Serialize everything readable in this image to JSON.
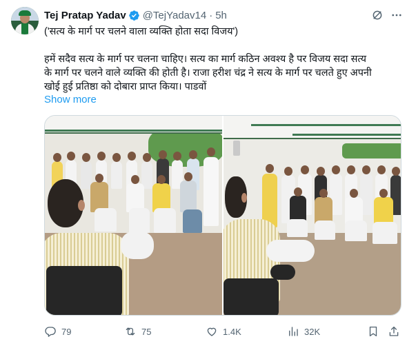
{
  "author": {
    "name": "Tej Pratap Yadav",
    "handle": "@TejYadav14",
    "separator": "·",
    "time": "5h",
    "avatar_icon": "profile-avatar"
  },
  "tweet": {
    "line1": "('सत्य के मार्ग पर चलने वाला व्यक्ति होता सदा विजय')",
    "body_lines": [
      "हमें सदैव सत्य के मार्ग पर चलना चाहिए। सत्य का मार्ग कठिन अवश्य है पर विजय सदा सत्य",
      "के मार्ग पर चलने वाले व्यक्ति की होती है। राजा हरीश चंद्र ने सत्य के मार्ग पर चलते हुए अपनी",
      "खोई हुई प्रतिष्ठा को दोबारा प्राप्त किया। पाडवों"
    ],
    "show_more": "Show more"
  },
  "media": {
    "count": 2,
    "icons": [
      "photo-meeting-left",
      "photo-meeting-right"
    ]
  },
  "actions": {
    "replies": "79",
    "reposts": "75",
    "likes": "1.4K",
    "views": "32K"
  },
  "colors": {
    "accent": "#1d9bf0",
    "text": "#0f1419",
    "muted": "#536471",
    "border": "#cfd9de"
  }
}
